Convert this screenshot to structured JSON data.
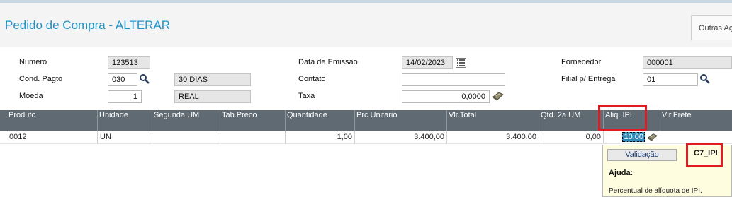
{
  "page": {
    "title": "Pedido de Compra - ALTERAR",
    "other_actions_label": "Outras Açõ"
  },
  "form": {
    "numero": {
      "label": "Numero",
      "value": "123513"
    },
    "cond_pagto": {
      "label": "Cond. Pagto",
      "value": "030",
      "description": "30 DIAS"
    },
    "moeda": {
      "label": "Moeda",
      "value": "1",
      "description": "REAL"
    },
    "data_emissao": {
      "label": "Data de Emissao",
      "value": "14/02/2023"
    },
    "contato": {
      "label": "Contato",
      "value": ""
    },
    "taxa": {
      "label": "Taxa",
      "value": "0,0000"
    },
    "fornecedor": {
      "label": "Fornecedor",
      "value": "000001"
    },
    "filial_entrega": {
      "label": "Filial p/ Entrega",
      "value": "01"
    }
  },
  "grid": {
    "columns": [
      "Produto",
      "Unidade",
      "Segunda UM",
      "Tab.Preco",
      "Quantidade",
      "Prc Unitario",
      "Vlr.Total",
      "Qtd. 2a UM",
      "Aliq. IPI",
      "Vlr.Frete"
    ],
    "row": {
      "produto": "0012",
      "unidade": "UN",
      "segunda_um": "",
      "tab_preco": "",
      "quantidade": "1,00",
      "prc_unitario": "3.400,00",
      "vlr_total": "3.400,00",
      "qtd_2a_um": "0,00",
      "aliq_ipi": "10,00",
      "vlr_frete": ""
    }
  },
  "help_popup": {
    "validation_label": "Validação",
    "field_name": "C7_IPI",
    "help_label": "Ajuda:",
    "help_text": "Percentual de alíquota de IPI."
  },
  "icons": {
    "search": "magnifier-icon",
    "calendar": "calendar-icon",
    "calculator": "calculator-icon"
  },
  "colors": {
    "title": "#1f93c8",
    "grid_header": "#5f6a73",
    "highlight": "#e11b22",
    "selected_cell": "#2e8bbd",
    "help_bg": "#fffde0"
  }
}
